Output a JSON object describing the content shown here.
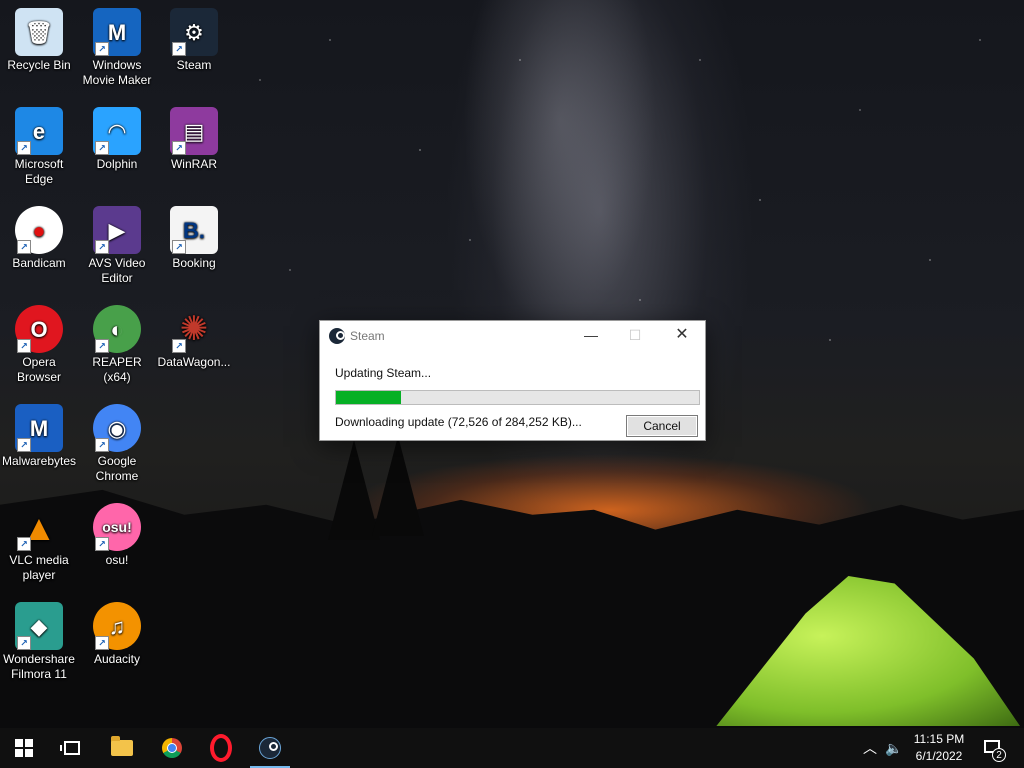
{
  "desktop": {
    "icons": [
      {
        "label": "Recycle Bin",
        "icon": "recycle-bin-icon",
        "glyph": "🗑",
        "color": "#cfe3f3"
      },
      {
        "label": "Windows Movie Maker",
        "icon": "movie-maker-icon",
        "glyph": "M",
        "color": "#1565c0"
      },
      {
        "label": "Steam",
        "icon": "steam-icon",
        "glyph": "⚙",
        "color": "#1b2838"
      },
      {
        "label": "Microsoft Edge",
        "icon": "edge-icon",
        "glyph": "e",
        "color": "#1e88e5"
      },
      {
        "label": "Dolphin",
        "icon": "dolphin-icon",
        "glyph": "◠",
        "color": "#2aa3ff"
      },
      {
        "label": "WinRAR",
        "icon": "winrar-icon",
        "glyph": "▤",
        "color": "#8e3a9e"
      },
      {
        "label": "Bandicam",
        "icon": "bandicam-icon",
        "glyph": "●",
        "color": "#ffffff"
      },
      {
        "label": "AVS Video Editor",
        "icon": "avs-video-editor-icon",
        "glyph": "▶",
        "color": "#5b3a8e"
      },
      {
        "label": "Booking",
        "icon": "booking-icon",
        "glyph": "B.",
        "color": "#f4f4f4"
      },
      {
        "label": "Opera Browser",
        "icon": "opera-icon",
        "glyph": "O",
        "color": "#e0161f"
      },
      {
        "label": "REAPER (x64)",
        "icon": "reaper-icon",
        "glyph": "◐",
        "color": "#48a04a"
      },
      {
        "label": "DataWagon...",
        "icon": "datawagon-icon",
        "glyph": "✺",
        "color": "#8a1d1d"
      },
      {
        "label": "Malwarebytes",
        "icon": "malwarebytes-icon",
        "glyph": "M",
        "color": "#1a5fc2"
      },
      {
        "label": "Google Chrome",
        "icon": "chrome-icon",
        "glyph": "◉",
        "color": "#4285f4"
      },
      {
        "label": "VLC media player",
        "icon": "vlc-icon",
        "glyph": "▲",
        "color": "#f08a00"
      },
      {
        "label": "osu!",
        "icon": "osu-icon",
        "glyph": "osu!",
        "color": "#ff66aa"
      },
      {
        "label": "Wondershare Filmora 11",
        "icon": "filmora-icon",
        "glyph": "◆",
        "color": "#2a9d8f"
      },
      {
        "label": "Audacity",
        "icon": "audacity-icon",
        "glyph": "♫",
        "color": "#f39200"
      }
    ]
  },
  "dialog": {
    "title": "Steam",
    "minimize_glyph": "—",
    "maximize_glyph": "☐",
    "close_glyph": "✕",
    "status": "Updating Steam...",
    "progress_fraction": 0.18,
    "download_status": "Downloading update (72,526 of 284,252 KB)...",
    "cancel_label": "Cancel"
  },
  "taskbar": {
    "tray_chevron": "︿",
    "volume_glyph": "🔈",
    "time": "11:15 PM",
    "date": "6/1/2022",
    "notification_count": "2"
  },
  "colors": {
    "progress": "#06b025",
    "taskbar": "#101010",
    "accent": "#76b9ed"
  }
}
